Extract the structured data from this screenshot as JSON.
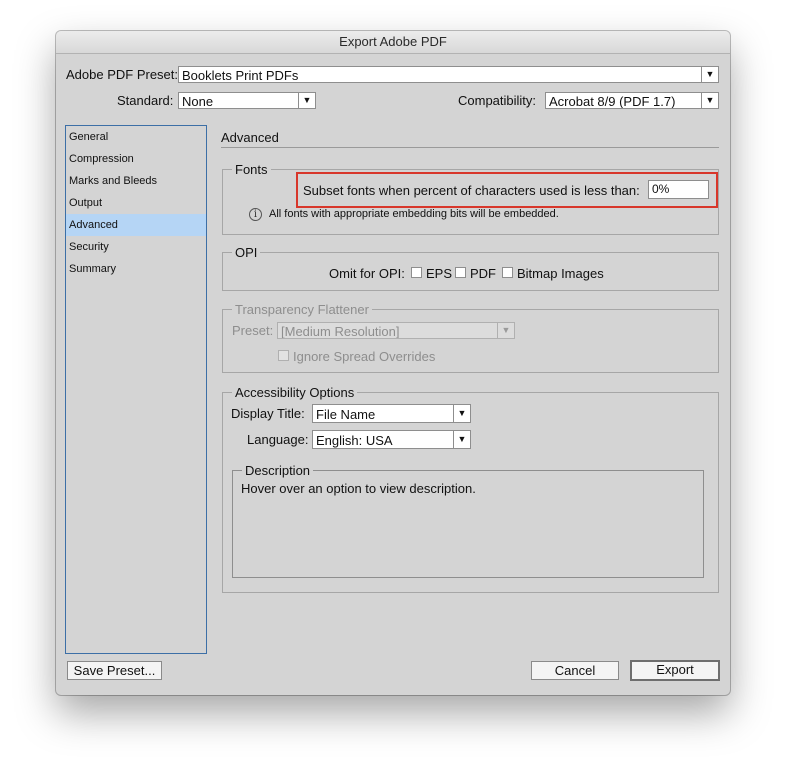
{
  "window": {
    "title": "Export Adobe PDF"
  },
  "top": {
    "preset_label": "Adobe PDF Preset:",
    "preset_value": "Booklets Print PDFs",
    "standard_label": "Standard:",
    "standard_value": "None",
    "compat_label": "Compatibility:",
    "compat_value": "Acrobat 8/9 (PDF 1.7)"
  },
  "sidebar": {
    "items": [
      {
        "label": "General"
      },
      {
        "label": "Compression"
      },
      {
        "label": "Marks and Bleeds"
      },
      {
        "label": "Output"
      },
      {
        "label": "Advanced"
      },
      {
        "label": "Security"
      },
      {
        "label": "Summary"
      }
    ],
    "selected": "Advanced"
  },
  "panel": {
    "title": "Advanced",
    "fonts": {
      "title": "Fonts",
      "subset_label": "Subset fonts when percent of characters used is less than:",
      "subset_value": "0%",
      "info_text": "All fonts with appropriate embedding bits will be embedded.",
      "info_icon": "i"
    },
    "opi": {
      "title": "OPI",
      "omit_label": "Omit for OPI:",
      "eps_label": "EPS",
      "pdf_label": "PDF",
      "bitmap_label": "Bitmap Images"
    },
    "flattener": {
      "title": "Transparency Flattener",
      "preset_label": "Preset:",
      "preset_value": "[Medium Resolution]",
      "ignore_label": "Ignore Spread Overrides"
    },
    "accessibility": {
      "title": "Accessibility Options",
      "display_title_label": "Display Title:",
      "display_title_value": "File Name",
      "language_label": "Language:",
      "language_value": "English: USA",
      "description_title": "Description",
      "description_text": "Hover over an option to view description."
    }
  },
  "buttons": {
    "save_preset": "Save Preset...",
    "cancel": "Cancel",
    "export": "Export"
  },
  "colors": {
    "highlight": "#d8372b",
    "selection": "#b5d5f5",
    "sidebar_border": "#3c6fa6"
  }
}
